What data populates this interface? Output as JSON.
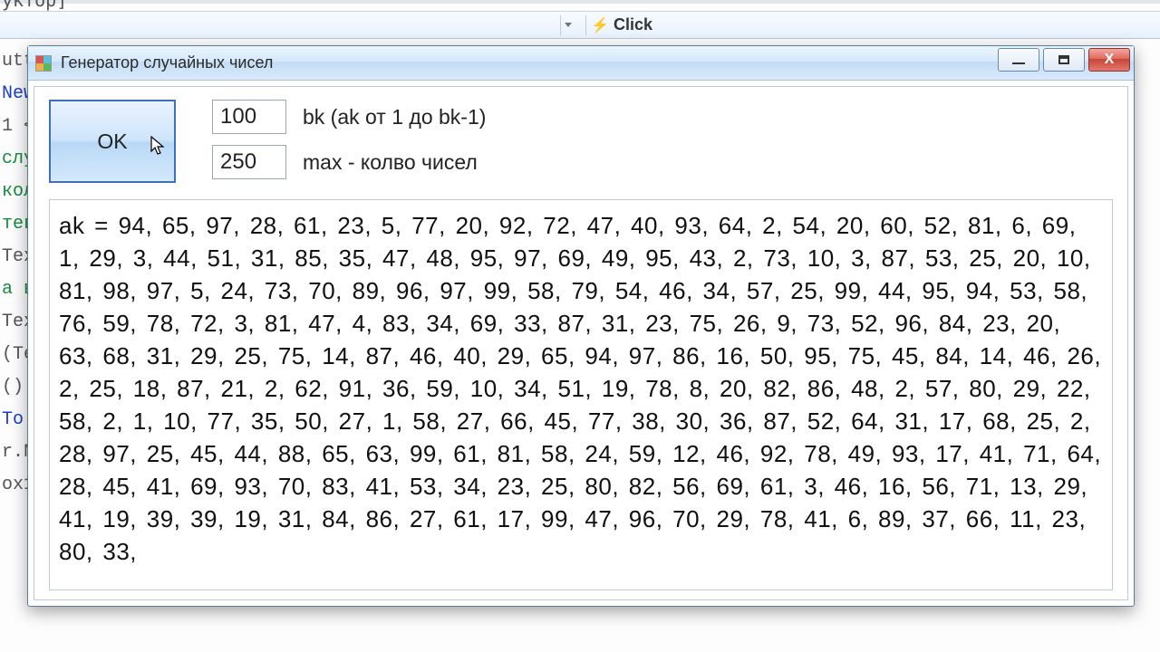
{
  "toolbar": {
    "event_label": "Click"
  },
  "code_fragments": [
    {
      "text": "уктор]",
      "cls": ""
    },
    {
      "text": "",
      "cls": ""
    },
    {
      "text": "utt",
      "cls": ""
    },
    {
      "text": "New",
      "cls": "kw-blue"
    },
    {
      "text": "1 <",
      "cls": ""
    },
    {
      "text": "слу",
      "cls": "kw-green"
    },
    {
      "text": "кол",
      "cls": "kw-green"
    },
    {
      "text": "",
      "cls": ""
    },
    {
      "text": "тек",
      "cls": "kw-green"
    },
    {
      "text": "Tex",
      "cls": ""
    },
    {
      "text": "а в",
      "cls": "kw-green"
    },
    {
      "text": "Tex",
      "cls": ""
    },
    {
      "text": "(Te",
      "cls": ""
    },
    {
      "text": "",
      "cls": ""
    },
    {
      "text": "()",
      "cls": ""
    },
    {
      "text": "To",
      "cls": "kw-blue"
    },
    {
      "text": "",
      "cls": ""
    },
    {
      "text": "r.N",
      "cls": ""
    },
    {
      "text": "",
      "cls": ""
    },
    {
      "text": "ox1",
      "cls": ""
    }
  ],
  "dialog": {
    "title": "Генератор случайных чисел",
    "ok_label": "OK",
    "bk": {
      "value": "100",
      "label": "bk  (ak от 1 до bk-1)"
    },
    "max": {
      "value": "250",
      "label": "max - колво чисел"
    },
    "output_prefix": "ak = ",
    "numbers": [
      94,
      65,
      97,
      28,
      61,
      23,
      5,
      77,
      20,
      92,
      72,
      47,
      40,
      93,
      64,
      2,
      54,
      20,
      60,
      52,
      81,
      6,
      69,
      1,
      29,
      3,
      44,
      51,
      31,
      85,
      35,
      47,
      48,
      95,
      97,
      69,
      49,
      95,
      43,
      2,
      73,
      10,
      3,
      87,
      53,
      25,
      20,
      10,
      81,
      98,
      97,
      5,
      24,
      73,
      70,
      89,
      96,
      97,
      99,
      58,
      79,
      54,
      46,
      34,
      57,
      25,
      99,
      44,
      95,
      94,
      53,
      58,
      76,
      59,
      78,
      72,
      3,
      81,
      47,
      4,
      83,
      34,
      69,
      33,
      87,
      31,
      23,
      75,
      26,
      9,
      73,
      52,
      96,
      84,
      23,
      20,
      63,
      68,
      31,
      29,
      25,
      75,
      14,
      87,
      46,
      40,
      29,
      65,
      94,
      97,
      86,
      16,
      50,
      95,
      75,
      45,
      84,
      14,
      46,
      26,
      2,
      25,
      18,
      87,
      21,
      2,
      62,
      91,
      36,
      59,
      10,
      34,
      51,
      19,
      78,
      8,
      20,
      82,
      86,
      48,
      2,
      57,
      80,
      29,
      22,
      58,
      2,
      1,
      10,
      77,
      35,
      50,
      27,
      1,
      58,
      27,
      66,
      45,
      77,
      38,
      30,
      36,
      87,
      52,
      64,
      31,
      17,
      68,
      25,
      2,
      28,
      97,
      25,
      45,
      44,
      88,
      65,
      63,
      99,
      61,
      81,
      58,
      24,
      59,
      12,
      46,
      92,
      78,
      49,
      93,
      17,
      41,
      71,
      64,
      28,
      45,
      41,
      69,
      93,
      70,
      83,
      41,
      53,
      34,
      23,
      25,
      80,
      82,
      56,
      69,
      61,
      3,
      46,
      16,
      56,
      71,
      13,
      29,
      41,
      19,
      39,
      39,
      19,
      31,
      84,
      86,
      27,
      61,
      17,
      99,
      47,
      96,
      70,
      29,
      78,
      41,
      6,
      89,
      37,
      66,
      11,
      23,
      80,
      33
    ]
  }
}
